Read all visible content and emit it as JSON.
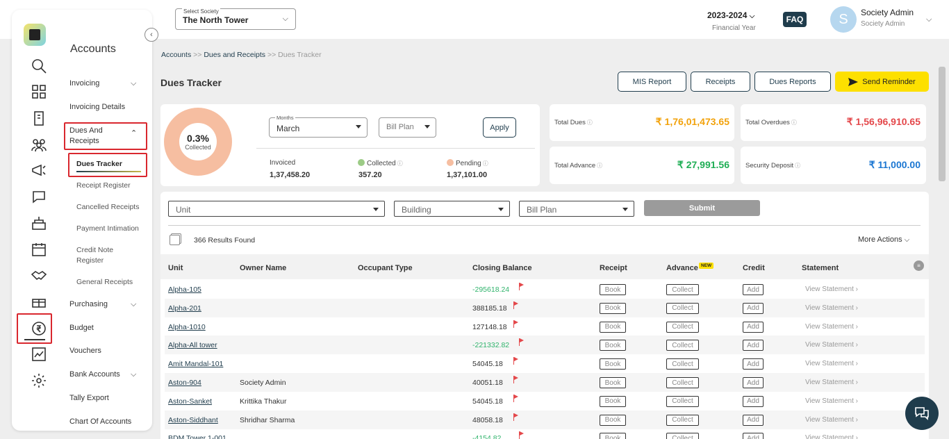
{
  "header": {
    "society_label": "Select Society",
    "society_value": "The North Tower",
    "financial_year": "2023-2024",
    "financial_year_label": "Financial Year",
    "faq": "FAQ",
    "avatar_initial": "S",
    "user_name": "Society Admin",
    "user_role": "Society Admin"
  },
  "sidebar": {
    "title": "Accounts",
    "menu": [
      {
        "label": "Invoicing",
        "chevron": "down"
      },
      {
        "label": "Invoicing Details"
      },
      {
        "label": "Dues And Receipts",
        "chevron": "up"
      },
      {
        "label": "Purchasing",
        "chevron": "down"
      },
      {
        "label": "Budget"
      },
      {
        "label": "Vouchers"
      },
      {
        "label": "Bank Accounts",
        "chevron": "down"
      },
      {
        "label": "Tally Export"
      },
      {
        "label": "Chart Of Accounts"
      }
    ],
    "submenu": [
      "Dues Tracker",
      "Receipt Register",
      "Cancelled Receipts",
      "Payment Intimation",
      "Credit Note Register",
      "General Receipts"
    ]
  },
  "breadcrumb": {
    "items": [
      "Accounts",
      "Dues and Receipts",
      "Dues Tracker"
    ],
    "sep": " >> "
  },
  "page": {
    "title": "Dues Tracker",
    "buttons": [
      "MIS Report",
      "Receipts",
      "Dues Reports"
    ],
    "send_reminder": "Send Reminder"
  },
  "summary": {
    "percent": "0.3%",
    "percent_label": "Collected",
    "months_label": "Months",
    "months_value": "March",
    "bill_plan_placeholder": "Bill Plan",
    "apply": "Apply",
    "invoiced_label": "Invoiced",
    "invoiced_value": "1,37,458.20",
    "collected_label": "Collected",
    "collected_value": "357.20",
    "pending_label": "Pending",
    "pending_value": "1,37,101.00",
    "collected_color": "#9ccb86",
    "pending_color": "#f6bea1"
  },
  "kpis": {
    "total_dues_label": "Total Dues",
    "total_dues_value": "₹ 1,76,01,473.65",
    "total_overdues_label": "Total Overdues",
    "total_overdues_value": "₹ 1,56,96,910.65",
    "total_advance_label": "Total Advance",
    "total_advance_value": "₹ 27,991.56",
    "security_deposit_label": "Security Deposit",
    "security_deposit_value": "₹ 11,000.00"
  },
  "filters": {
    "unit": "Unit",
    "building": "Building",
    "bill_plan": "Bill Plan",
    "submit": "Submit"
  },
  "results_text": "366 Results Found",
  "more_actions": "More Actions",
  "table": {
    "headers": [
      "Unit",
      "Owner Name",
      "Occupant Type",
      "Closing Balance",
      "Receipt",
      "Advance",
      "Credit",
      "Statement"
    ],
    "new_badge": "NEW",
    "book": "Book",
    "collect": "Collect",
    "add": "Add",
    "view_statement": "View Statement ›",
    "rows": [
      {
        "unit": "Alpha-105",
        "owner": "",
        "balance": "-295618.24",
        "negative": true
      },
      {
        "unit": "Alpha-201",
        "owner": "",
        "balance": "388185.18",
        "negative": false
      },
      {
        "unit": "Alpha-1010",
        "owner": "",
        "balance": "127148.18",
        "negative": false
      },
      {
        "unit": "Alpha-All tower",
        "owner": "",
        "balance": "-221332.82",
        "negative": true
      },
      {
        "unit": "Amit Mandal-101",
        "owner": "",
        "balance": "54045.18",
        "negative": false
      },
      {
        "unit": "Aston-904",
        "owner": "Society Admin",
        "balance": "40051.18",
        "negative": false
      },
      {
        "unit": "Aston-Sanket",
        "owner": "Krittika Thakur",
        "balance": "54045.18",
        "negative": false
      },
      {
        "unit": "Aston-Siddhant",
        "owner": "Shridhar Sharma",
        "balance": "48058.18",
        "negative": false
      },
      {
        "unit": "BDM Tower 1-001",
        "owner": "",
        "balance": "-4154.82",
        "negative": true
      }
    ]
  },
  "icons": [
    "search-icon",
    "dashboard-icon",
    "building-icon",
    "people-icon",
    "megaphone-icon",
    "chat-icon",
    "amenity-icon",
    "calendar-icon",
    "handshake-icon",
    "gift-icon",
    "rupee-icon",
    "report-icon",
    "gear-icon"
  ]
}
